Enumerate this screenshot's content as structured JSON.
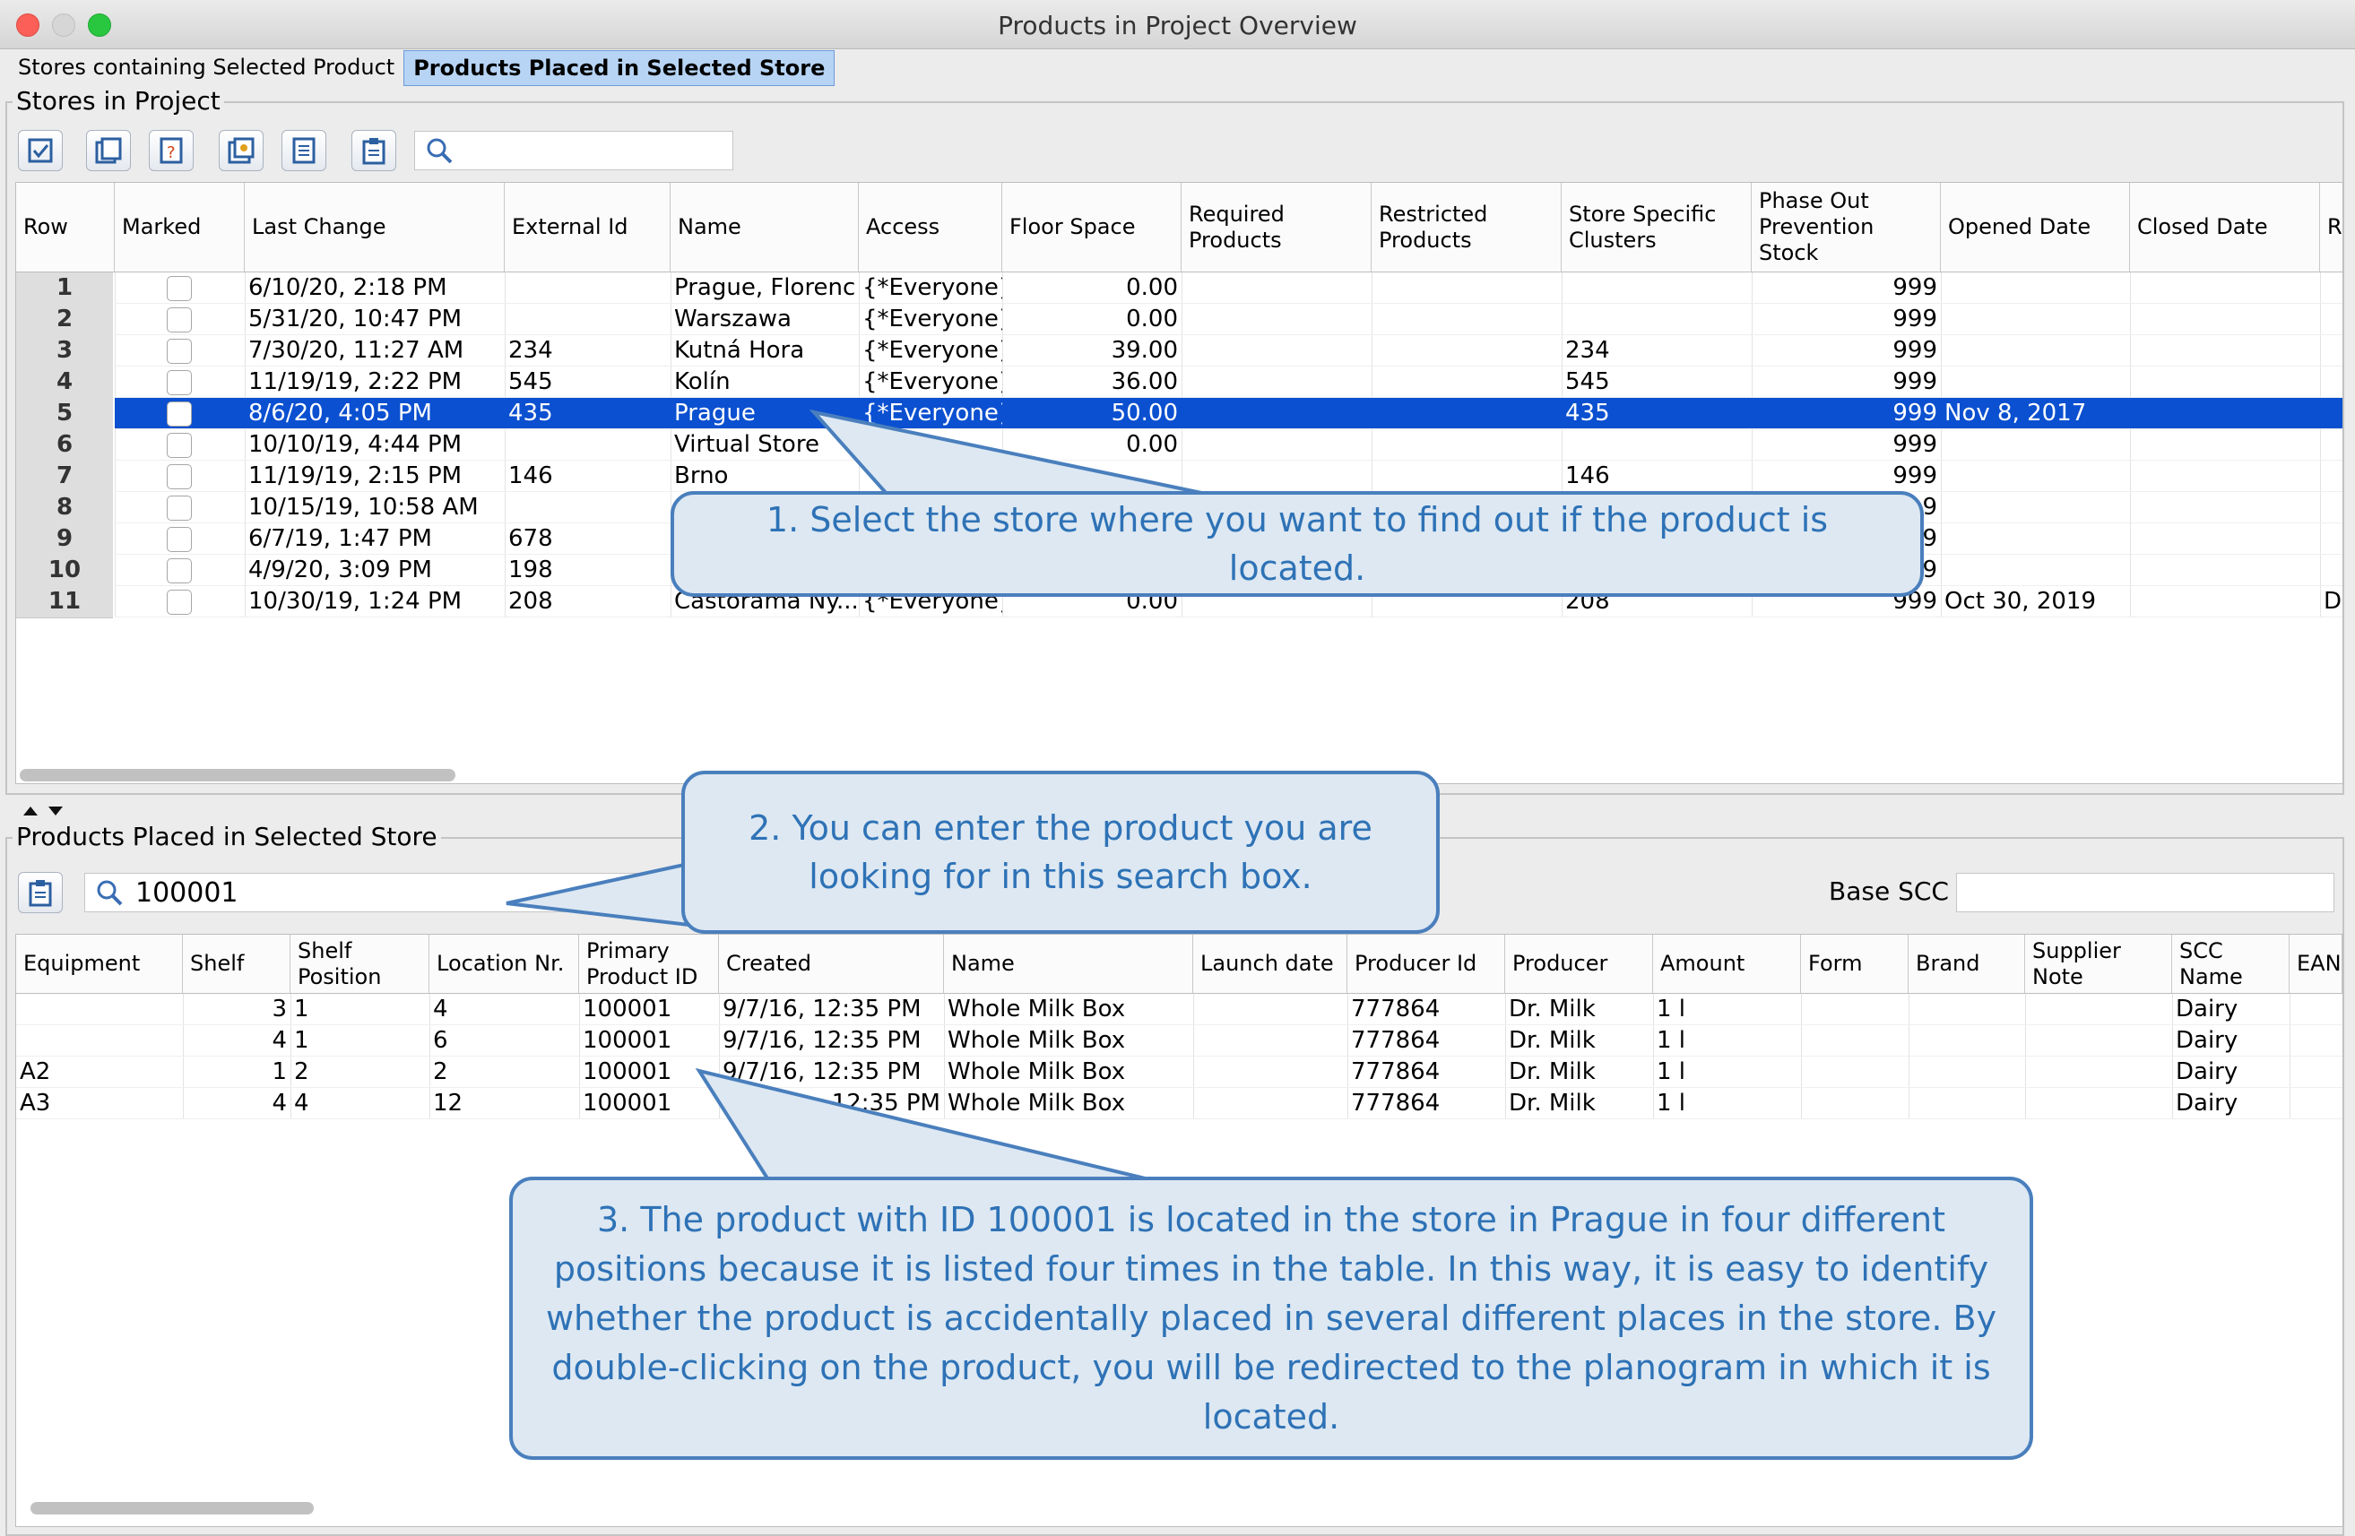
{
  "window": {
    "title": "Products in Project Overview"
  },
  "tabs": [
    {
      "label": "Stores containing Selected Product",
      "active": false
    },
    {
      "label": "Products Placed in Selected Store",
      "active": true
    }
  ],
  "stores_section": {
    "title": "Stores in Project",
    "toolbar_icons": [
      "select-all-icon",
      "copy-icon",
      "help-doc-icon",
      "image-export-icon",
      "list-icon",
      "clipboard-icon"
    ],
    "search_value": "",
    "columns": [
      "Row",
      "Marked",
      "Last Change",
      "External Id",
      "Name",
      "Access",
      "Floor Space",
      "Required Products",
      "Restricted Products",
      "Store Specific Clusters",
      "Phase Out Prevention Stock",
      "Opened Date",
      "Closed Date",
      "Re"
    ],
    "rows": [
      {
        "row": "1",
        "last_change": "6/10/20, 2:18 PM",
        "external_id": "",
        "name": "Prague, Florenc",
        "access": "{*Everyone}",
        "floor_space": "0.00",
        "clusters": "",
        "phase_out": "999",
        "opened": "",
        "closed": "",
        "re": ""
      },
      {
        "row": "2",
        "last_change": "5/31/20, 10:47 PM",
        "external_id": "",
        "name": "Warszawa",
        "access": "{*Everyone}",
        "floor_space": "0.00",
        "clusters": "",
        "phase_out": "999",
        "opened": "",
        "closed": "",
        "re": ""
      },
      {
        "row": "3",
        "last_change": "7/30/20, 11:27 AM",
        "external_id": "234",
        "name": "Kutná Hora",
        "access": "{*Everyone}",
        "floor_space": "39.00",
        "clusters": "234",
        "phase_out": "999",
        "opened": "",
        "closed": "",
        "re": ""
      },
      {
        "row": "4",
        "last_change": "11/19/19, 2:22 PM",
        "external_id": "545",
        "name": "Kolín",
        "access": "{*Everyone}",
        "floor_space": "36.00",
        "clusters": "545",
        "phase_out": "999",
        "opened": "",
        "closed": "",
        "re": ""
      },
      {
        "row": "5",
        "last_change": "8/6/20, 4:05 PM",
        "external_id": "435",
        "name": "Prague",
        "access": "{*Everyone}",
        "floor_space": "50.00",
        "clusters": "435",
        "phase_out": "999",
        "opened": "Nov 8, 2017",
        "closed": "",
        "re": ""
      },
      {
        "row": "6",
        "last_change": "10/10/19, 4:44 PM",
        "external_id": "",
        "name": "Virtual Store",
        "access": "",
        "floor_space": "0.00",
        "clusters": "",
        "phase_out": "999",
        "opened": "",
        "closed": "",
        "re": ""
      },
      {
        "row": "7",
        "last_change": "11/19/19, 2:15 PM",
        "external_id": "146",
        "name": "Brno",
        "access": "",
        "floor_space": "",
        "clusters": "146",
        "phase_out": "999",
        "opened": "",
        "closed": "",
        "re": ""
      },
      {
        "row": "8",
        "last_change": "10/15/19, 10:58 AM",
        "external_id": "",
        "name": "",
        "access": "",
        "floor_space": "",
        "clusters": "",
        "phase_out": "9",
        "opened": "",
        "closed": "",
        "re": ""
      },
      {
        "row": "9",
        "last_change": "6/7/19, 1:47 PM",
        "external_id": "678",
        "name": "",
        "access": "",
        "floor_space": "",
        "clusters": "",
        "phase_out": "9",
        "opened": "",
        "closed": "",
        "re": ""
      },
      {
        "row": "10",
        "last_change": "4/9/20, 3:09 PM",
        "external_id": "198",
        "name": "",
        "access": "",
        "floor_space": "",
        "clusters": "",
        "phase_out": "9",
        "opened": "",
        "closed": "",
        "re": ""
      },
      {
        "row": "11",
        "last_change": "10/30/19, 1:24 PM",
        "external_id": "208",
        "name": "Castorama Ny...",
        "access": "{*Everyone}",
        "floor_space": "0.00",
        "clusters": "208",
        "phase_out": "999",
        "opened": "Oct 30, 2019",
        "closed": "",
        "re": "De"
      }
    ],
    "selected_row": 5
  },
  "products_section": {
    "title": "Products Placed in Selected Store",
    "search_value": "100001",
    "base_scc_label": "Base SCC",
    "base_scc_value": "",
    "columns": [
      "Equipment",
      "Shelf",
      "Shelf Position",
      "Location Nr.",
      "Primary Product ID",
      "Created",
      "Name",
      "Launch date",
      "Producer Id",
      "Producer",
      "Amount",
      "Form",
      "Brand",
      "Supplier Note",
      "SCC Name",
      "EAN"
    ],
    "rows": [
      {
        "equipment": "",
        "shelf": "3",
        "shelf_position": "1",
        "location": "4",
        "product_id": "100001",
        "created": "9/7/16, 12:35 PM",
        "name": "Whole Milk Box",
        "producer_id": "777864",
        "producer": "Dr. Milk",
        "amount": "1 l",
        "scc": "Dairy"
      },
      {
        "equipment": "",
        "shelf": "4",
        "shelf_position": "1",
        "location": "6",
        "product_id": "100001",
        "created": "9/7/16, 12:35 PM",
        "name": "Whole Milk Box",
        "producer_id": "777864",
        "producer": "Dr. Milk",
        "amount": "1 l",
        "scc": "Dairy"
      },
      {
        "equipment": "A2",
        "shelf": "1",
        "shelf_position": "2",
        "location": "2",
        "product_id": "100001",
        "created": "9/7/16, 12:35 PM",
        "name": "Whole Milk Box",
        "producer_id": "777864",
        "producer": "Dr. Milk",
        "amount": "1 l",
        "scc": "Dairy"
      },
      {
        "equipment": "A3",
        "shelf": "4",
        "shelf_position": "4",
        "location": "12",
        "product_id": "100001",
        "created": "12:35 PM",
        "name": "Whole Milk Box",
        "producer_id": "777864",
        "producer": "Dr. Milk",
        "amount": "1 l",
        "scc": "Dairy"
      }
    ]
  },
  "callouts": [
    "1. Select the store where you want to find out if the product is located.",
    "2. You can enter the product you are looking for in this search box.",
    "3. The product with ID 100001 is located in the store in Prague in four different positions because it is listed four times in the table. In this way, it is easy to identify whether the product is accidentally placed in several different places in the store. By double-clicking on the product, you will be redirected to the planogram in which it is located."
  ],
  "colors": {
    "selection": "#0b50d0",
    "callout_bg": "#dde8f2",
    "callout_border": "#4a7fbd",
    "callout_text": "#2e72b6",
    "tab_active": "#b7d4f5"
  }
}
